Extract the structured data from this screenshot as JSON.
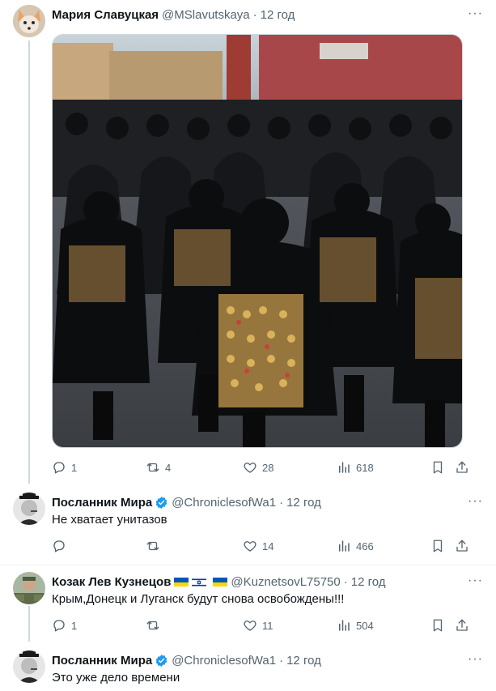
{
  "tweets": [
    {
      "name": "Мария Славуцкая",
      "handle": "@MSlavutskaya",
      "time": "12 год",
      "text": "",
      "replies": "1",
      "retweets": "4",
      "likes": "28",
      "views": "618",
      "verified": false,
      "has_media": true
    },
    {
      "name": "Посланник Мира",
      "handle": "@ChroniclesofWa1",
      "time": "12 год",
      "text": "Не хватает унитазов",
      "replies": "",
      "retweets": "",
      "likes": "14",
      "views": "466",
      "verified": true
    },
    {
      "name": "Козак Лев Кузнецов",
      "handle": "@KuznetsovL75750",
      "time": "12 год",
      "text": "Крым,Донецк и Луганск будут снова освобождены!!!",
      "replies": "1",
      "retweets": "",
      "likes": "11",
      "views": "504",
      "verified": false,
      "flags": [
        "ukraine-flag",
        "israel-flag",
        "ukraine-flag"
      ]
    },
    {
      "name": "Посланник Мира",
      "handle": "@ChroniclesofWa1",
      "time": "12 год",
      "text": "Это уже дело времени",
      "verified": true
    }
  ],
  "ui": {
    "dot": "·",
    "more": "···"
  },
  "colors": {
    "text": "#0f1419",
    "muted": "#536471",
    "verified": "#1d9bf0",
    "thread_line": "#cfd9de",
    "divider": "#eff3f4"
  }
}
